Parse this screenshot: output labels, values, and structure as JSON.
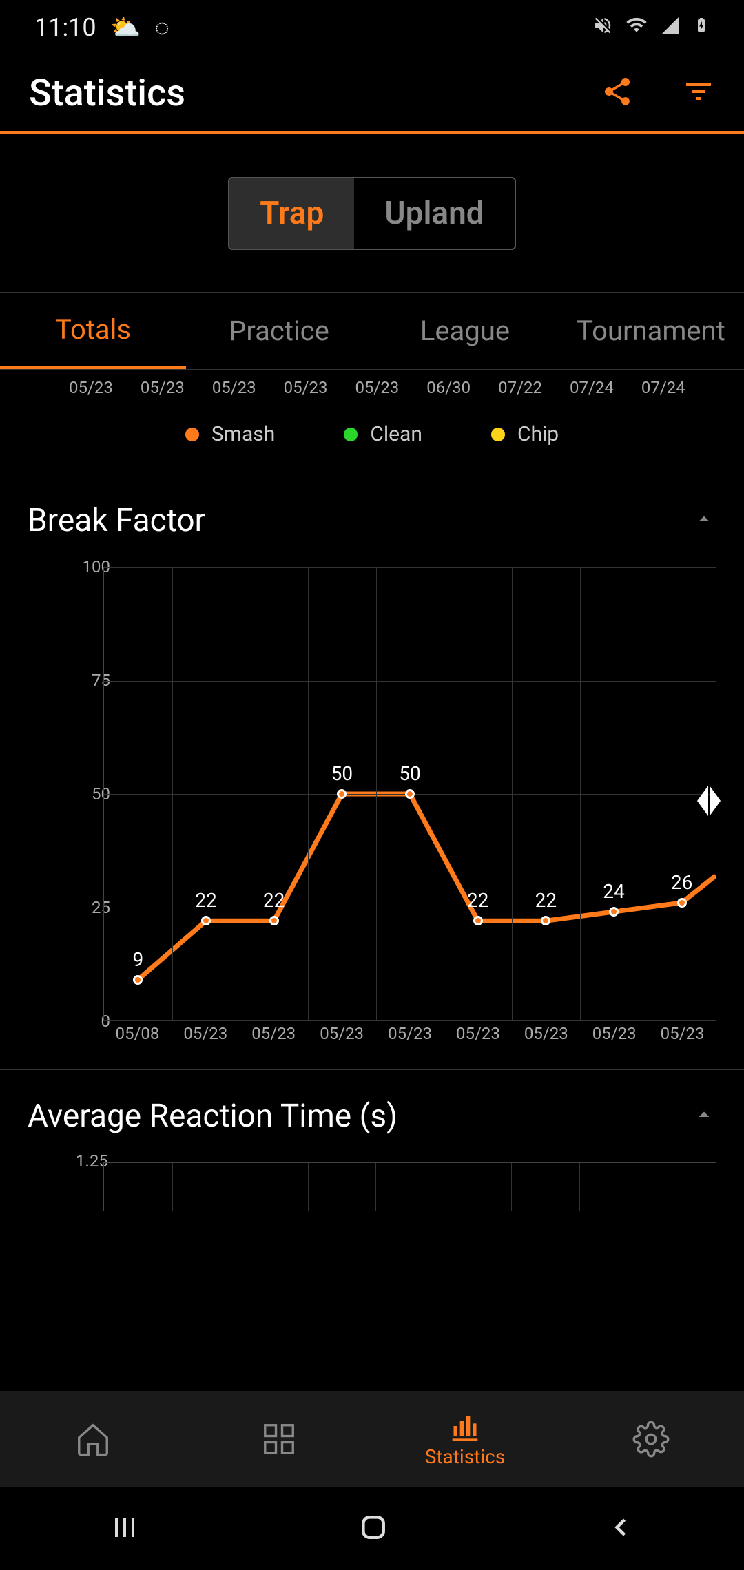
{
  "status": {
    "time": "11:10"
  },
  "header": {
    "title": "Statistics"
  },
  "modes": {
    "trap": "Trap",
    "upland": "Upland"
  },
  "tabs": {
    "totals": "Totals",
    "practice": "Practice",
    "league": "League",
    "tournament": "Tournament"
  },
  "top_dates": [
    "05/23",
    "05/23",
    "05/23",
    "05/23",
    "05/23",
    "06/30",
    "07/22",
    "07/24",
    "07/24"
  ],
  "legend": {
    "smash": "Smash",
    "clean": "Clean",
    "chip": "Chip"
  },
  "legend_colors": {
    "smash": "#ff7a1a",
    "clean": "#29d629",
    "chip": "#ffd21a"
  },
  "section1": {
    "title": "Break Factor"
  },
  "section2": {
    "title": "Average Reaction Time (s)",
    "ymax_label": "1.25"
  },
  "bottomnav": {
    "statistics": "Statistics"
  },
  "chart_data": {
    "type": "line",
    "title": "Break Factor",
    "xlabel": "",
    "ylabel": "",
    "ylim": [
      0,
      100
    ],
    "y_ticks": [
      0,
      25,
      50,
      75,
      100
    ],
    "categories": [
      "05/08",
      "05/23",
      "05/23",
      "05/23",
      "05/23",
      "05/23",
      "05/23",
      "05/23",
      "05/23"
    ],
    "values": [
      9,
      22,
      22,
      50,
      50,
      22,
      22,
      24,
      26
    ],
    "series_color": "#ff7a1a"
  }
}
